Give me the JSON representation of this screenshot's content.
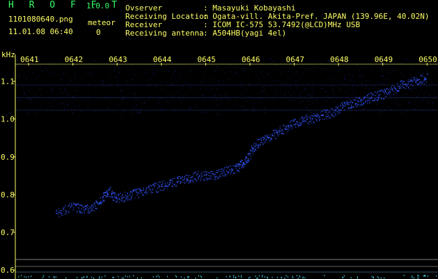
{
  "header": {
    "app_name": "H R O F F T",
    "app_version": "1.0.0",
    "file_name": "1101080640.png",
    "timestamp": "11.01.08 06:40",
    "meteor_label": "meteor",
    "meteor_count": "0",
    "info": [
      {
        "key": "Ovserver",
        "value": ": Masayuki Kobayashi"
      },
      {
        "key": "Receiving Location",
        "value": ": Ogata-vill. Akita-Pref. JAPAN (139.96E, 40.02N)"
      },
      {
        "key": "Receiver",
        "value": ": ICOM IC-575 53.7492(@LCD)MHz USB"
      },
      {
        "key": "Receiving antenna",
        "value": ": A504HB(yagi 4el)"
      }
    ]
  },
  "chart_data": {
    "type": "scatter",
    "title": "",
    "ylabel": "kHz",
    "xlabel": "",
    "x_ticks": [
      "0641",
      "0642",
      "0643",
      "0644",
      "0645",
      "0646",
      "0647",
      "0648",
      "0649",
      "0650"
    ],
    "y_ticks": [
      "1.1",
      "1.0",
      "0.9",
      "0.8",
      "0.7",
      "0.6"
    ],
    "ylim": [
      0.58,
      1.16
    ],
    "xlim": [
      640.7,
      650.2
    ],
    "trace_color": "#3355ff",
    "trace": [
      {
        "x": 641.6,
        "y": 0.75
      },
      {
        "x": 642.0,
        "y": 0.77
      },
      {
        "x": 642.3,
        "y": 0.76
      },
      {
        "x": 642.6,
        "y": 0.78
      },
      {
        "x": 642.8,
        "y": 0.81
      },
      {
        "x": 643.0,
        "y": 0.79
      },
      {
        "x": 643.3,
        "y": 0.8
      },
      {
        "x": 643.6,
        "y": 0.81
      },
      {
        "x": 643.9,
        "y": 0.82
      },
      {
        "x": 644.2,
        "y": 0.83
      },
      {
        "x": 644.5,
        "y": 0.84
      },
      {
        "x": 644.8,
        "y": 0.85
      },
      {
        "x": 645.1,
        "y": 0.85
      },
      {
        "x": 645.4,
        "y": 0.86
      },
      {
        "x": 645.7,
        "y": 0.87
      },
      {
        "x": 645.9,
        "y": 0.89
      },
      {
        "x": 646.1,
        "y": 0.93
      },
      {
        "x": 646.4,
        "y": 0.95
      },
      {
        "x": 646.7,
        "y": 0.97
      },
      {
        "x": 647.0,
        "y": 0.99
      },
      {
        "x": 647.3,
        "y": 1.0
      },
      {
        "x": 647.6,
        "y": 1.01
      },
      {
        "x": 647.9,
        "y": 1.02
      },
      {
        "x": 648.2,
        "y": 1.04
      },
      {
        "x": 648.5,
        "y": 1.05
      },
      {
        "x": 648.8,
        "y": 1.06
      },
      {
        "x": 649.1,
        "y": 1.07
      },
      {
        "x": 649.4,
        "y": 1.09
      },
      {
        "x": 649.7,
        "y": 1.1
      },
      {
        "x": 650.0,
        "y": 1.11
      }
    ],
    "background_color": "#000000",
    "axis_color": "#ffff66",
    "grid": false,
    "legend": "none"
  }
}
